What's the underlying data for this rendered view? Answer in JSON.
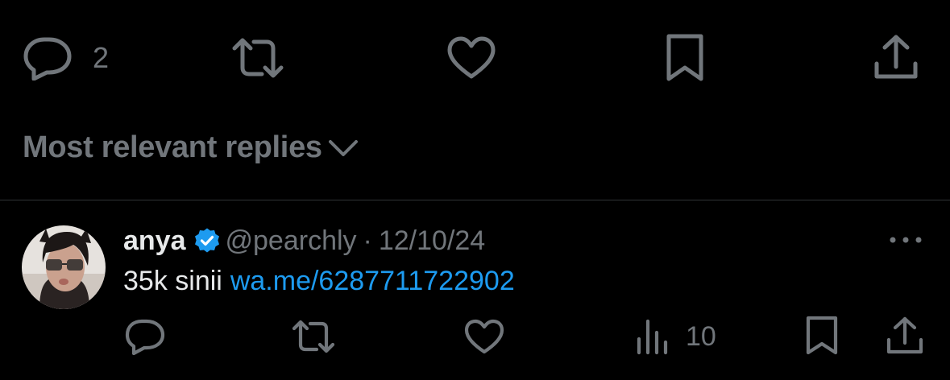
{
  "top_actions": {
    "reply_count": "2",
    "icons": [
      "reply-icon",
      "retweet-icon",
      "heart-icon",
      "bookmark-icon",
      "share-icon"
    ]
  },
  "sort": {
    "label": "Most relevant replies",
    "icon": "chevron-down-icon"
  },
  "reply": {
    "author_name": "anya",
    "verified": true,
    "handle": "@pearchly",
    "separator": "·",
    "date": "12/10/24",
    "text": "35k sinii",
    "link_text": "wa.me/6287711722902",
    "views_count": "10",
    "icons": [
      "reply-icon",
      "retweet-icon",
      "heart-icon",
      "views-icon",
      "bookmark-icon",
      "share-icon",
      "more-icon"
    ]
  },
  "colors": {
    "background": "#000000",
    "primary_text": "#e7e9ea",
    "secondary_text": "#71767b",
    "link": "#1d9bf0",
    "verified_badge": "#1d9bf0",
    "divider": "#2f3336"
  }
}
